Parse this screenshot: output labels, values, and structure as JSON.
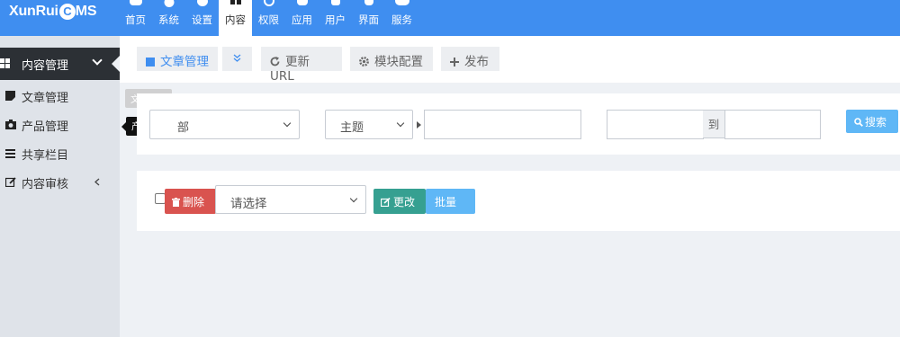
{
  "app": {
    "logo_prefix": "XunRui",
    "logo_c": "C",
    "logo_suffix": "MS"
  },
  "colors": {
    "primary": "#3f8ef0",
    "danger": "#d9534f",
    "success": "#36a091",
    "info": "#5fb7f6"
  },
  "topnav": [
    {
      "label": "首页",
      "icon": "home-icon"
    },
    {
      "label": "系统",
      "icon": "globe-icon"
    },
    {
      "label": "设置",
      "icon": "gears-icon"
    },
    {
      "label": "内容",
      "icon": "grid-icon",
      "active": true
    },
    {
      "label": "权限",
      "icon": "user-circle-icon"
    },
    {
      "label": "应用",
      "icon": "puzzle-icon"
    },
    {
      "label": "用户",
      "icon": "user-icon"
    },
    {
      "label": "界面",
      "icon": "html5-icon"
    },
    {
      "label": "服务",
      "icon": "cloud-icon"
    }
  ],
  "sidebar": {
    "section": "内容管理",
    "items": [
      {
        "label": "文章管理",
        "icon": "document-icon"
      },
      {
        "label": "产品管理",
        "icon": "camera-icon"
      },
      {
        "label": "共享栏目",
        "icon": "list-icon"
      },
      {
        "label": "内容审核",
        "icon": "edit-icon"
      }
    ]
  },
  "tooltips": {
    "article": "文章管理",
    "product": "产品管理"
  },
  "tabs": [
    {
      "label": "文章管理"
    },
    {
      "label": ""
    },
    {
      "label": "更新URL"
    },
    {
      "label": "模块配置"
    },
    {
      "label": "发布"
    }
  ],
  "filter": {
    "category_value": "部",
    "field_value": "主题",
    "keyword": "",
    "date_from": "",
    "date_to": "",
    "to_label": "到",
    "search_label": "搜索"
  },
  "actions": {
    "delete_label": "删除",
    "select_placeholder": "请选择",
    "change_label": "更改",
    "batch_label": "批量"
  }
}
